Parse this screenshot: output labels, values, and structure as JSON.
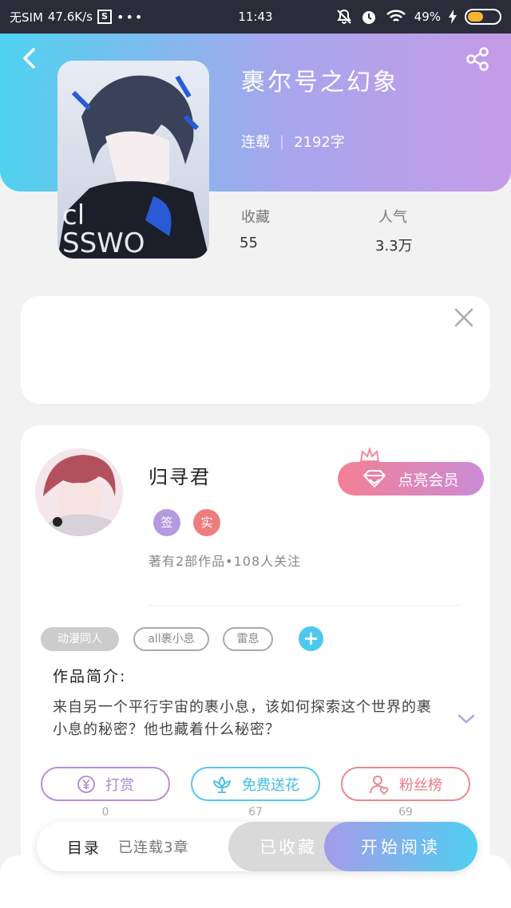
{
  "status_bar": {
    "carrier": "无SIM",
    "speed": "47.6K/s",
    "sbox": "S",
    "dots": "•••",
    "time": "11:43",
    "battery": "49%",
    "battery_level": 0.49
  },
  "book": {
    "title": "裹尔号之幻象",
    "status": "连载",
    "separator": "|",
    "word_count": "2192字",
    "favorites_label": "收藏",
    "favorites_value": "55",
    "popularity_label": "人气",
    "popularity_value": "3.3万"
  },
  "author": {
    "name": "归寻君",
    "badge_1": "签",
    "badge_2": "实",
    "info": "著有2部作品•108人关注",
    "vip_label": "点亮会员"
  },
  "tags": [
    "动漫同人",
    "all裹小息",
    "雷息"
  ],
  "intro": {
    "title": "作品简介:",
    "text": "来自另一个平行宇宙的裹小息，该如何探索这个世界的裹小息的秘密？他也藏着什么秘密？"
  },
  "actions": [
    {
      "label": "打赏",
      "count": "0",
      "icon": "yen-circle-icon"
    },
    {
      "label": "免费送花",
      "count": "67",
      "icon": "flower-icon"
    },
    {
      "label": "粉丝榜",
      "count": "69",
      "icon": "fan-user-icon"
    }
  ],
  "bottom": {
    "toc": "目录",
    "chapters": "已连载3章",
    "collected": "已收藏",
    "start_read": "开始阅读"
  },
  "colors": {
    "header_start": "#4fd2ef",
    "header_end": "#c59be8",
    "accent_blue": "#4cc9ee",
    "accent_purple": "#a988d6",
    "accent_red": "#e97a86"
  }
}
